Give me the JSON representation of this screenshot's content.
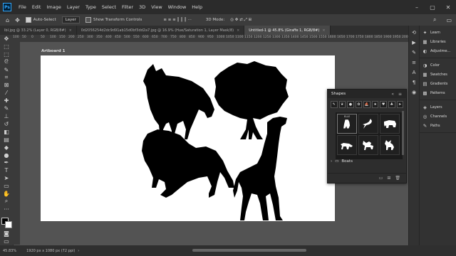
{
  "app": {
    "logo": "Ps",
    "menus": [
      "File",
      "Edit",
      "Image",
      "Layer",
      "Type",
      "Select",
      "Filter",
      "3D",
      "View",
      "Window",
      "Help"
    ],
    "window_controls": [
      "–",
      "▢",
      "✕"
    ]
  },
  "options": {
    "auto_select_label": "Auto-Select",
    "auto_select_target": "Layer",
    "transform_controls_label": "Show Transform Controls",
    "mode_3d_label": "3D Mode:"
  },
  "tabs": [
    {
      "label": "lbl.jpg @ 33.2% (Layer 0, RGB/8#)",
      "active": false
    },
    {
      "label": "0d2056254d2dc9d91ab15d0bf3dd2a7.jpg @ 16.9% (Hue/Saturation 1, Layer Mask/8)",
      "active": false
    },
    {
      "label": "Untitled-1 @ 45.8% (Giraffe 1, RGB/8#)",
      "active": true
    }
  ],
  "ruler_ticks": [
    "100",
    "50",
    "0",
    "50",
    "100",
    "150",
    "200",
    "250",
    "300",
    "350",
    "400",
    "450",
    "500",
    "550",
    "600",
    "650",
    "700",
    "750",
    "800",
    "850",
    "900",
    "950",
    "1000",
    "1050",
    "1100",
    "1150",
    "1200",
    "1250",
    "1300",
    "1350",
    "1400",
    "1450",
    "1500",
    "1550",
    "1600",
    "1650",
    "1700",
    "1750",
    "1800",
    "1850",
    "1900",
    "1950",
    "2000",
    "2050"
  ],
  "artboard": {
    "label": "Artboard 1"
  },
  "status": {
    "zoom": "45.83%",
    "doc_info": "1920 px x 1080 px (72 ppi)"
  },
  "right_panel": {
    "groups": [
      [
        {
          "icon": "bulb-icon",
          "glyph": "💡",
          "label": "Learn"
        },
        {
          "icon": "libraries-icon",
          "glyph": "▦",
          "label": "Libraries"
        },
        {
          "icon": "adjustments-icon",
          "glyph": "◐",
          "label": "Adjustme..."
        }
      ],
      [
        {
          "icon": "color-icon",
          "glyph": "◑",
          "label": "Color"
        },
        {
          "icon": "swatches-icon",
          "glyph": "▦",
          "label": "Swatches"
        },
        {
          "icon": "gradients-icon",
          "glyph": "▤",
          "label": "Gradients"
        },
        {
          "icon": "patterns-icon",
          "glyph": "▩",
          "label": "Patterns"
        }
      ],
      [
        {
          "icon": "layers-icon",
          "glyph": "◈",
          "label": "Layers"
        },
        {
          "icon": "channels-icon",
          "glyph": "◎",
          "label": "Channels"
        },
        {
          "icon": "paths-icon",
          "glyph": "✎",
          "label": "Paths"
        }
      ]
    ]
  },
  "shapes_panel": {
    "title": "Shapes",
    "selected_caption": "ELLE",
    "folder_label": "Boats",
    "menu_glyph": "≡",
    "collapse_glyph": "«"
  }
}
